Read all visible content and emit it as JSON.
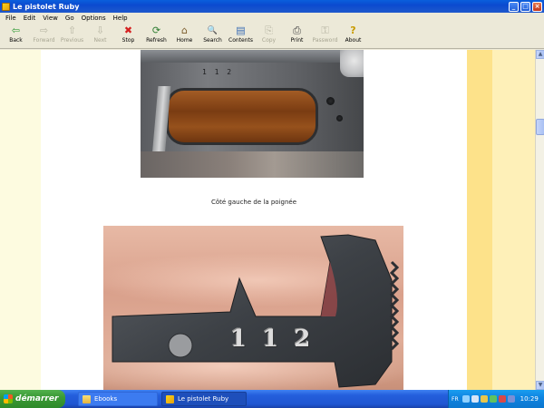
{
  "window": {
    "title": "Le pistolet Ruby",
    "minimize_glyph": "_",
    "maximize_glyph": "□",
    "close_glyph": "×"
  },
  "menu": [
    "File",
    "Edit",
    "View",
    "Go",
    "Options",
    "Help"
  ],
  "toolbar": [
    {
      "label": "Back",
      "icon": "back-arrow-icon",
      "glyph": "⇦",
      "enabled": true
    },
    {
      "label": "Forward",
      "icon": "forward-arrow-icon",
      "glyph": "⇨",
      "enabled": false
    },
    {
      "label": "Previous",
      "icon": "up-arrow-icon",
      "glyph": "⇧",
      "enabled": false
    },
    {
      "label": "Next",
      "icon": "down-arrow-icon",
      "glyph": "⇩",
      "enabled": false
    },
    {
      "label": "Stop",
      "icon": "stop-icon",
      "glyph": "✖",
      "enabled": true
    },
    {
      "label": "Refresh",
      "icon": "refresh-icon",
      "glyph": "⟳",
      "enabled": true
    },
    {
      "label": "Home",
      "icon": "home-icon",
      "glyph": "⌂",
      "enabled": true
    },
    {
      "label": "Search",
      "icon": "search-icon",
      "glyph": "🔍",
      "enabled": true
    },
    {
      "label": "Contents",
      "icon": "contents-icon",
      "glyph": "▤",
      "enabled": true
    },
    {
      "label": "Copy",
      "icon": "copy-icon",
      "glyph": "⎘",
      "enabled": false
    },
    {
      "label": "Print",
      "icon": "print-icon",
      "glyph": "⎙",
      "enabled": true
    },
    {
      "label": "Password",
      "icon": "password-icon",
      "glyph": "⚿",
      "enabled": false
    },
    {
      "label": "About",
      "icon": "about-icon",
      "glyph": "?",
      "enabled": true
    }
  ],
  "content": {
    "caption": "Côté gauche de la poignée",
    "photo1_serial": "1 1 2",
    "photo2_stamp": "1 1 2"
  },
  "scrollbar": {
    "up_glyph": "▲",
    "down_glyph": "▼"
  },
  "taskbar": {
    "start_label": "démarrer",
    "tasks": [
      {
        "label": "Ebooks",
        "icon": "folder-icon",
        "active": false
      },
      {
        "label": "Le pistolet Ruby",
        "icon": "ruby-app-icon",
        "active": true
      }
    ],
    "tray": {
      "language": "FR",
      "clock": "10:29",
      "icons": [
        "network-icon",
        "volume-icon",
        "security-icon",
        "messenger-icon",
        "mail-icon",
        "antivirus-icon"
      ]
    }
  },
  "colors": {
    "titlebar": "#0b4ad0",
    "page_bg": "#ffffff",
    "side_yellow": "#fde28a",
    "side_cream": "#fef0b8",
    "taskbar": "#245edc",
    "start_green": "#3b9a36"
  }
}
